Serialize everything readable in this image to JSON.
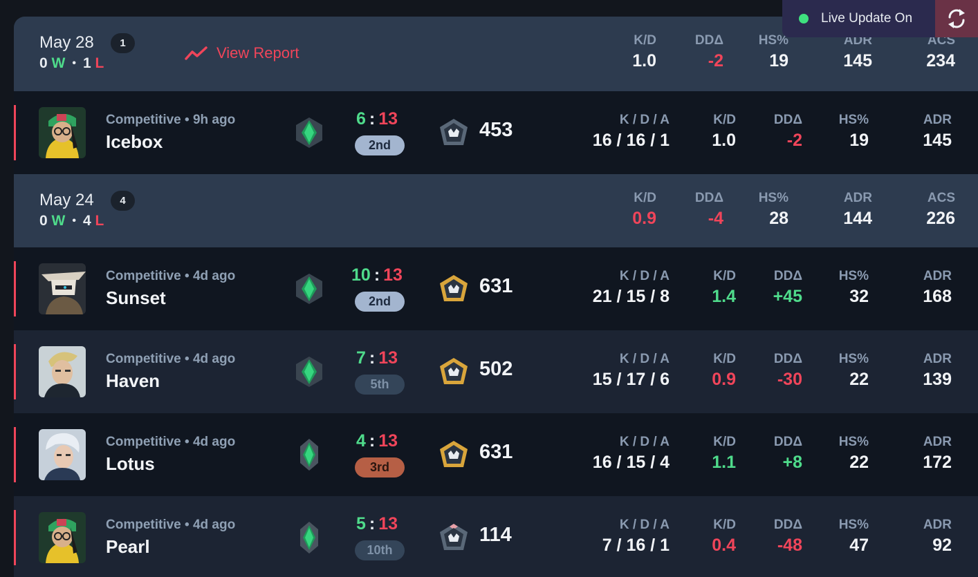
{
  "live_update": {
    "label": "Live Update On",
    "status_color": "#3fe07f"
  },
  "groups": [
    {
      "date": "May 28",
      "count": "1",
      "wins": "0",
      "losses": "1",
      "w": "W",
      "l": "L",
      "view_report": "View Report",
      "stats": {
        "kd_label": "K/D",
        "kd": "1.0",
        "dd_label": "DDΔ",
        "dd": "-2",
        "hs_label": "HS%",
        "hs": "19",
        "adr_label": "ADR",
        "adr": "145",
        "acs_label": "ACS",
        "acs": "234"
      }
    },
    {
      "date": "May 24",
      "count": "4",
      "wins": "0",
      "losses": "4",
      "w": "W",
      "l": "L",
      "stats": {
        "kd_label": "K/D",
        "kd": "0.9",
        "dd_label": "DDΔ",
        "dd": "-4",
        "hs_label": "HS%",
        "hs": "28",
        "adr_label": "ADR",
        "adr": "144",
        "acs_label": "ACS",
        "acs": "226"
      }
    }
  ],
  "matches": [
    {
      "agent": "viper-avatar",
      "mode": "Competitive • 9h ago",
      "map": "Icebox",
      "score_own": "6",
      "score_sep": ":",
      "score_opp": "13",
      "place": "2nd",
      "acs": "453",
      "kda_label": "K / D / A",
      "kda": "16 / 16 / 1",
      "kd_label": "K/D",
      "kd": "1.0",
      "dd_label": "DDΔ",
      "dd": "-2",
      "hs_label": "HS%",
      "hs": "19",
      "adr_label": "ADR",
      "adr": "145"
    },
    {
      "agent": "cypher-avatar",
      "mode": "Competitive • 4d ago",
      "map": "Sunset",
      "score_own": "10",
      "score_sep": ":",
      "score_opp": "13",
      "place": "2nd",
      "acs": "631",
      "kda_label": "K / D / A",
      "kda": "21 / 15 / 8",
      "kd_label": "K/D",
      "kd": "1.4",
      "dd_label": "DDΔ",
      "dd": "+45",
      "hs_label": "HS%",
      "hs": "32",
      "adr_label": "ADR",
      "adr": "168"
    },
    {
      "agent": "chamber-avatar",
      "mode": "Competitive • 4d ago",
      "map": "Haven",
      "score_own": "7",
      "score_sep": ":",
      "score_opp": "13",
      "place": "5th",
      "acs": "502",
      "kda_label": "K / D / A",
      "kda": "15 / 17 / 6",
      "kd_label": "K/D",
      "kd": "0.9",
      "dd_label": "DDΔ",
      "dd": "-30",
      "hs_label": "HS%",
      "hs": "22",
      "adr_label": "ADR",
      "adr": "139"
    },
    {
      "agent": "jett-avatar",
      "mode": "Competitive • 4d ago",
      "map": "Lotus",
      "score_own": "4",
      "score_sep": ":",
      "score_opp": "13",
      "place": "3rd",
      "acs": "631",
      "kda_label": "K / D / A",
      "kda": "16 / 15 / 4",
      "kd_label": "K/D",
      "kd": "1.1",
      "dd_label": "DDΔ",
      "dd": "+8",
      "hs_label": "HS%",
      "hs": "22",
      "adr_label": "ADR",
      "adr": "172"
    },
    {
      "agent": "viper-avatar",
      "mode": "Competitive • 4d ago",
      "map": "Pearl",
      "score_own": "5",
      "score_sep": ":",
      "score_opp": "13",
      "place": "10th",
      "acs": "114",
      "kda_label": "K / D / A",
      "kda": "7 / 16 / 1",
      "kd_label": "K/D",
      "kd": "0.4",
      "dd_label": "DDΔ",
      "dd": "-48",
      "hs_label": "HS%",
      "hs": "47",
      "adr_label": "ADR",
      "adr": "92"
    }
  ],
  "colors": {
    "win": "#4fdb8b",
    "loss": "#f0455a",
    "accent": "#f0455a"
  }
}
